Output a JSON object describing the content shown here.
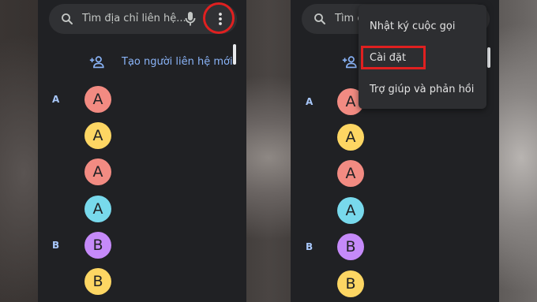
{
  "left_screen": {
    "search": {
      "placeholder": "Tìm địa chỉ liên hệ..."
    },
    "create_contact_label": "Tạo người liên hệ mới",
    "sections": [
      {
        "letter": "A",
        "contacts": [
          {
            "initial": "A",
            "color": "#f28b82"
          },
          {
            "initial": "A",
            "color": "#fdd663"
          },
          {
            "initial": "A",
            "color": "#f28b82"
          },
          {
            "initial": "A",
            "color": "#78d9ec"
          }
        ]
      },
      {
        "letter": "B",
        "contacts": [
          {
            "initial": "B",
            "color": "#c58af9"
          },
          {
            "initial": "B",
            "color": "#fdd663"
          }
        ]
      }
    ]
  },
  "right_screen": {
    "search": {
      "placeholder_partial": "Tìm c"
    },
    "menu": {
      "items": [
        "Nhật ký cuộc gọi",
        "Cài đặt",
        "Trợ giúp và phản hồi"
      ],
      "highlighted": "Cài đặt"
    },
    "sections": [
      {
        "letter": "A",
        "contacts": [
          {
            "initial": "A",
            "color": "#f28b82"
          },
          {
            "initial": "A",
            "color": "#fdd663"
          },
          {
            "initial": "A",
            "color": "#f28b82"
          },
          {
            "initial": "A",
            "color": "#78d9ec"
          }
        ]
      },
      {
        "letter": "B",
        "contacts": [
          {
            "initial": "B",
            "color": "#c58af9"
          },
          {
            "initial": "B",
            "color": "#fdd663"
          }
        ]
      }
    ]
  },
  "annotation_color": "#e02020"
}
